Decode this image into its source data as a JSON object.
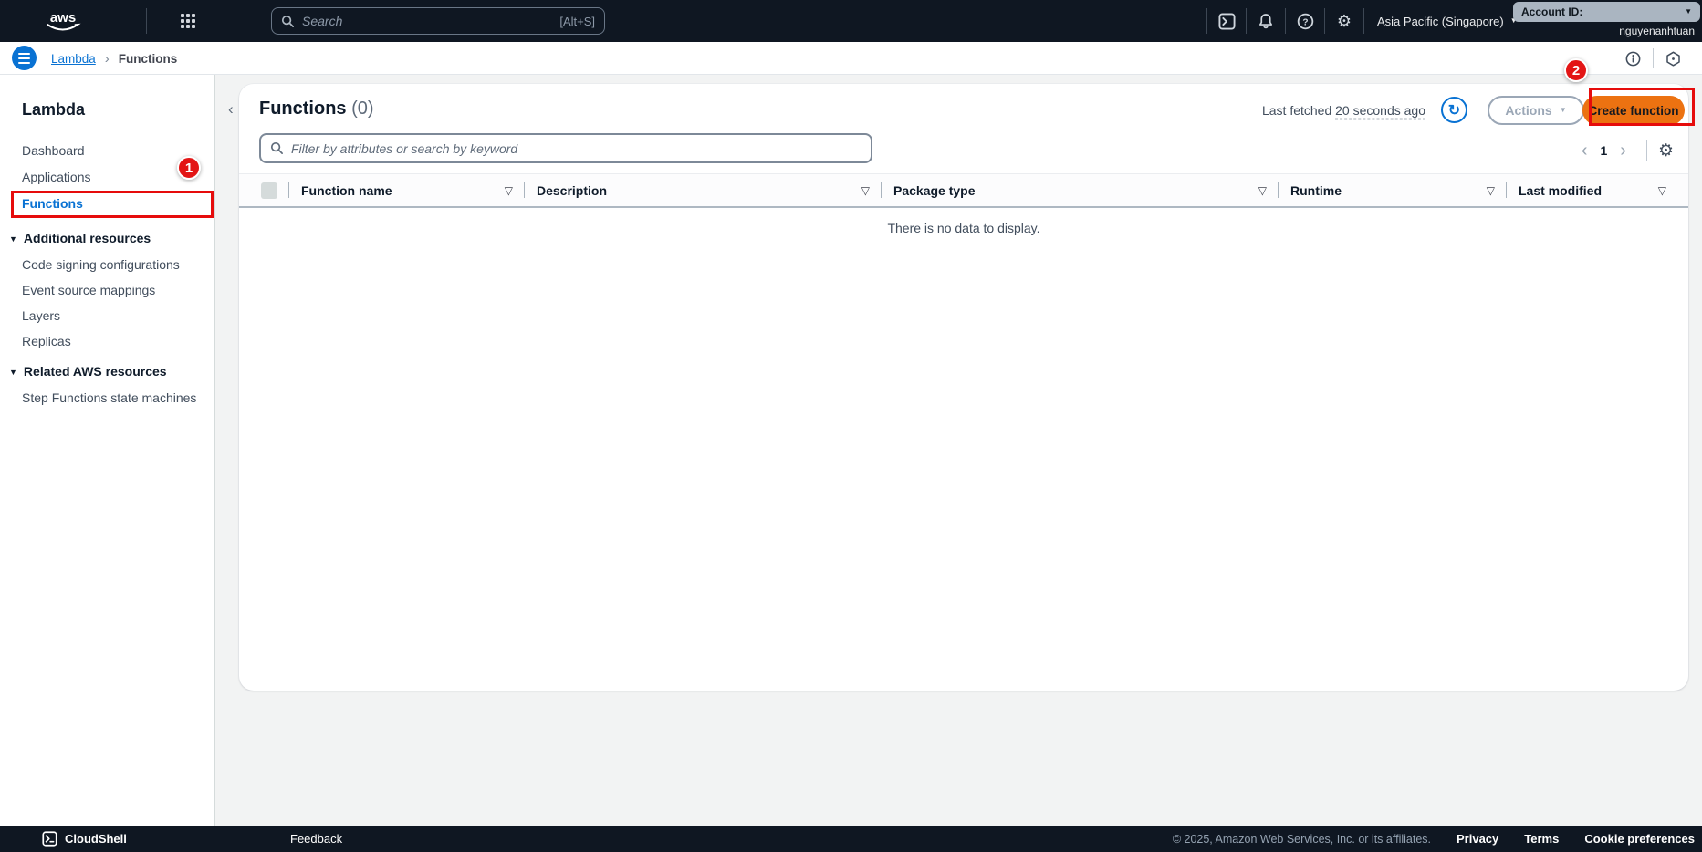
{
  "topbar": {
    "logo_text": "aws",
    "search": {
      "placeholder": "Search",
      "shortcut": "[Alt+S]"
    },
    "region": {
      "label": "Asia Pacific (Singapore)"
    },
    "account": {
      "label": "Account ID:",
      "username": "nguyenanhtuan"
    }
  },
  "breadcrumb": {
    "root": "Lambda",
    "current": "Functions"
  },
  "sidebar": {
    "title": "Lambda",
    "items": [
      {
        "label": "Dashboard"
      },
      {
        "label": "Applications"
      },
      {
        "label": "Functions"
      }
    ],
    "sections": [
      {
        "label": "Additional resources",
        "items": [
          "Code signing configurations",
          "Event source mappings",
          "Layers",
          "Replicas"
        ]
      },
      {
        "label": "Related AWS resources",
        "items": [
          "Step Functions state machines"
        ]
      }
    ]
  },
  "main": {
    "title": "Functions",
    "count": "(0)",
    "last_fetched_prefix": "Last fetched",
    "last_fetched_value": "20 seconds ago",
    "actions_label": "Actions",
    "create_function_label": "Create function",
    "filter_placeholder": "Filter by attributes or search by keyword",
    "pagination": {
      "page": "1"
    },
    "table": {
      "columns": [
        "Function name",
        "Description",
        "Package type",
        "Runtime",
        "Last modified"
      ],
      "empty_message": "There is no data to display."
    }
  },
  "annotations": {
    "step1": "1",
    "step2": "2"
  },
  "footer": {
    "cloudshell_label": "CloudShell",
    "feedback_label": "Feedback",
    "copyright": "© 2025, Amazon Web Services, Inc. or its affiliates.",
    "links": [
      "Privacy",
      "Terms",
      "Cookie preferences"
    ]
  },
  "colors": {
    "accent": "#0972d3",
    "topbar_bg": "#0f1722",
    "orange": "#ec7211",
    "annotation_red": "#e60c0c",
    "account_box_bg": "#aab5c1"
  }
}
